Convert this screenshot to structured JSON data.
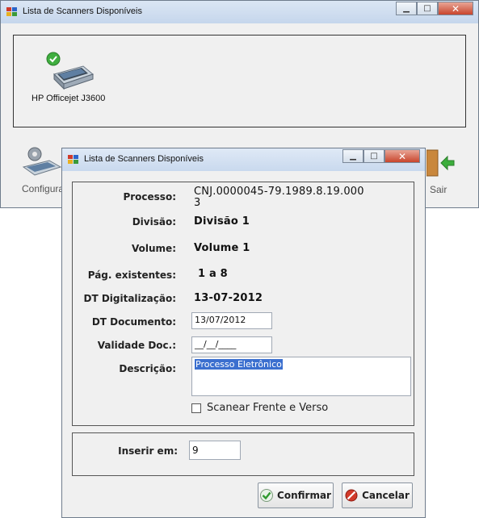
{
  "back_window": {
    "title": "Lista de Scanners Disponíveis",
    "scanners": [
      {
        "name": "HP Officejet J3600"
      }
    ],
    "toolbar": {
      "configure_label": "Configura",
      "exit_label": "Sair"
    }
  },
  "dialog": {
    "title": "Lista de Scanners Disponíveis",
    "fields": {
      "processo_label": "Processo:",
      "processo_value_line1": "CNJ.0000045-79.1989.8.19.000",
      "processo_value_line2": "3",
      "divisao_label": "Divisão:",
      "divisao_value": "Divisão 1",
      "volume_label": "Volume:",
      "volume_value": "Volume 1",
      "pag_label": "Pág. existentes:",
      "pag_value": "1 a 8",
      "dt_digitalizacao_label": "DT Digitalização:",
      "dt_digitalizacao_value": "13-07-2012",
      "dt_documento_label": "DT Documento:",
      "dt_documento_value": "13/07/2012",
      "validade_label": "Validade Doc.:",
      "validade_value": "__/__/____",
      "descricao_label": "Descrição:",
      "descricao_value": "Processo Eletrônico",
      "scan_both_label": "Scanear Frente e Verso"
    },
    "insert": {
      "label": "Inserir em:",
      "value": "9"
    },
    "buttons": {
      "confirm_label": "Confirmar",
      "cancel_label": "Cancelar"
    }
  }
}
